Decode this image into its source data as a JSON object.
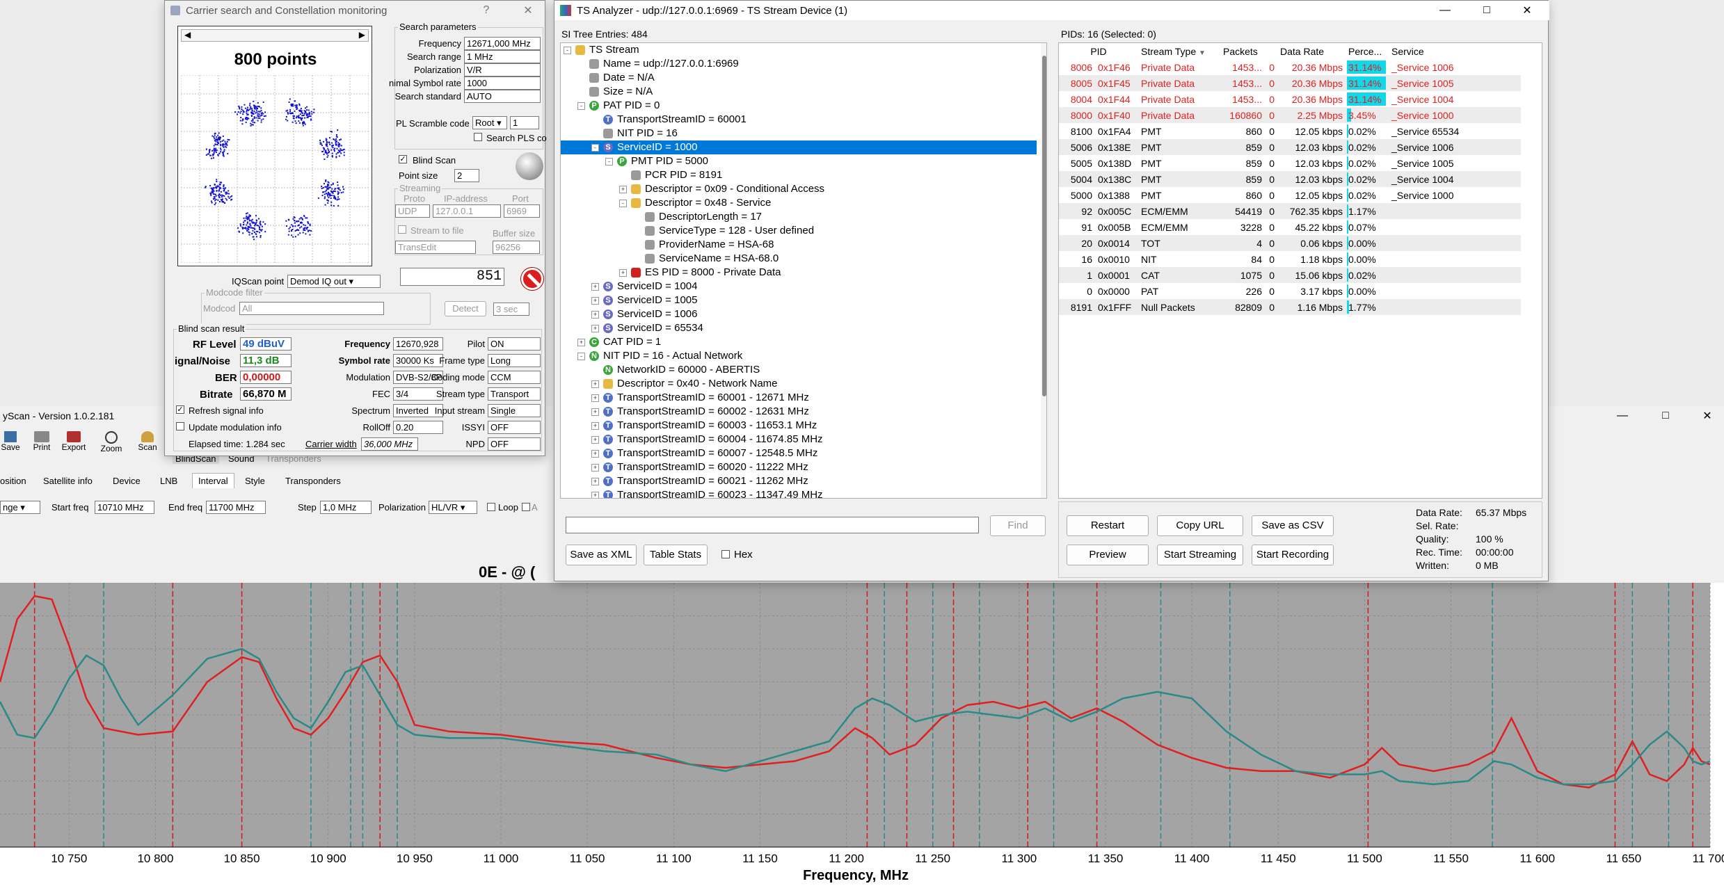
{
  "main": {
    "title": "yScan - Version 1.0.2.181",
    "toolbar": [
      "Save",
      "Print",
      "Export",
      "Zoom",
      "Scan",
      "BlindScan",
      "Sound",
      "Transponders"
    ],
    "tabs": [
      "osition",
      "Satellite info",
      "Device",
      "LNB",
      "Interval",
      "Style",
      "Transponders"
    ],
    "controls": {
      "range_value": "nge",
      "start_label": "Start freq",
      "start_value": "10710 MHz",
      "end_label": "End freq",
      "end_value": "11700 MHz",
      "step_label": "Step",
      "step_value": "1,0 MHz",
      "pol_label": "Polarization",
      "pol_value": "HL/VR",
      "loop_label": "Loop",
      "a_label": "A"
    },
    "chart_heading": "0E - @ ("
  },
  "carrier": {
    "title": "Carrier search and Constellation monitoring",
    "title_help": "?",
    "points_label": "800 points",
    "search_params_title": "Search parameters",
    "params": [
      {
        "label": "Frequency",
        "value": "12671,000 MHz"
      },
      {
        "label": "Search range",
        "value": "1 MHz"
      },
      {
        "label": "Polarization",
        "value": "V/R"
      },
      {
        "label": "nimal Symbol rate",
        "value": "1000"
      },
      {
        "label": "Search standard",
        "value": "AUTO"
      }
    ],
    "pls_label": "PL Scramble code",
    "pls_value": "Root",
    "pls_num": "1",
    "search_pls": "Search PLS co",
    "blind_scan": "Blind Scan",
    "point_size_label": "Point size",
    "point_size": "2",
    "streaming_title": "Streaming",
    "proto_label": "Proto",
    "ip_label": "IP-address",
    "port_label": "Port",
    "proto": "UDP",
    "ip": "127.0.0.1",
    "port": "6969",
    "stream_to_file": "Stream to file",
    "buffer_label": "Buffer size",
    "stream_app": "TransEdit",
    "buffer": "96256",
    "counter": "851",
    "iq_label": "IQScan point",
    "iq_value": "Demod IQ out",
    "modcode_title": "Modcode filter",
    "modcode_label": "Modcod",
    "modcode_value": "All",
    "detect": "Detect",
    "detect_time": "3 sec",
    "result_title": "Blind scan result",
    "rf_label": "RF Level",
    "rf_value": "49 dBuV",
    "snr_label": "ignal/Noise",
    "snr_value": "11,3 dB",
    "ber_label": "BER",
    "ber_value": "0,00000",
    "bitrate_label": "Bitrate",
    "bitrate_value": "66,870 M",
    "mid": [
      {
        "label": "Frequency",
        "value": "12670,928"
      },
      {
        "label": "Symbol rate",
        "value": "30000 Ks"
      },
      {
        "label": "Modulation",
        "value": "DVB-S2/8PSK"
      },
      {
        "label": "FEC",
        "value": "3/4"
      },
      {
        "label": "Spectrum",
        "value": "Inverted"
      },
      {
        "label": "RollOff",
        "value": "0.20"
      }
    ],
    "right": [
      {
        "label": "Pilot",
        "value": "ON"
      },
      {
        "label": "Frame type",
        "value": "Long"
      },
      {
        "label": "Coding mode",
        "value": "CCM"
      },
      {
        "label": "Stream type",
        "value": "Transport"
      },
      {
        "label": "Input stream",
        "value": "Single"
      },
      {
        "label": "ISSYI",
        "value": "OFF"
      },
      {
        "label": "NPD",
        "value": "OFF"
      }
    ],
    "refresh": "Refresh signal info",
    "update_mod": "Update modulation info",
    "elapsed": "Elapsed time: 1.284 sec",
    "carrier_width_label": "Carrier width",
    "carrier_width": "36,000 MHz"
  },
  "ts": {
    "title": "TS Analyzer - udp://127.0.0.1:6969 - TS Stream Device (1)",
    "si_header": "SI Tree Entries: 484",
    "pids_header": "PIDs: 16   (Selected: 0)",
    "tree": [
      {
        "d": 0,
        "pm": "-",
        "icon": "folder",
        "text": "TS Stream"
      },
      {
        "d": 1,
        "pm": "",
        "icon": "grey",
        "text": "Name = udp://127.0.0.1:6969"
      },
      {
        "d": 1,
        "pm": "",
        "icon": "grey",
        "text": "Date = N/A"
      },
      {
        "d": 1,
        "pm": "",
        "icon": "grey",
        "text": "Size = N/A"
      },
      {
        "d": 1,
        "pm": "-",
        "icon": "P",
        "text": "PAT PID = 0"
      },
      {
        "d": 2,
        "pm": "",
        "icon": "T",
        "text": "TransportStreamID = 60001"
      },
      {
        "d": 2,
        "pm": "",
        "icon": "grey",
        "text": "NIT PID = 16"
      },
      {
        "d": 2,
        "pm": "-",
        "icon": "S",
        "text": "ServiceID = 1000",
        "sel": true
      },
      {
        "d": 3,
        "pm": "-",
        "icon": "P",
        "text": "PMT PID = 5000"
      },
      {
        "d": 4,
        "pm": "",
        "icon": "grey",
        "text": "PCR PID = 8191"
      },
      {
        "d": 4,
        "pm": "+",
        "icon": "folder",
        "text": "Descriptor = 0x09 - Conditional Access"
      },
      {
        "d": 4,
        "pm": "-",
        "icon": "folder",
        "text": "Descriptor = 0x48 - Service"
      },
      {
        "d": 5,
        "pm": "",
        "icon": "grey",
        "text": "DescriptorLength = 17"
      },
      {
        "d": 5,
        "pm": "",
        "icon": "grey",
        "text": "ServiceType = 128 - User defined"
      },
      {
        "d": 5,
        "pm": "",
        "icon": "grey",
        "text": "ProviderName = HSA-68"
      },
      {
        "d": 5,
        "pm": "",
        "icon": "grey",
        "text": "ServiceName = HSA-68.0"
      },
      {
        "d": 4,
        "pm": "+",
        "icon": "red",
        "text": "ES PID = 8000 - Private Data"
      },
      {
        "d": 2,
        "pm": "+",
        "icon": "S",
        "text": "ServiceID = 1004"
      },
      {
        "d": 2,
        "pm": "+",
        "icon": "S",
        "text": "ServiceID = 1005"
      },
      {
        "d": 2,
        "pm": "+",
        "icon": "S",
        "text": "ServiceID = 1006"
      },
      {
        "d": 2,
        "pm": "+",
        "icon": "S",
        "text": "ServiceID = 65534"
      },
      {
        "d": 1,
        "pm": "+",
        "icon": "C",
        "text": "CAT PID = 1"
      },
      {
        "d": 1,
        "pm": "-",
        "icon": "N",
        "text": "NIT PID = 16 - Actual Network"
      },
      {
        "d": 2,
        "pm": "",
        "icon": "N",
        "text": "NetworkID = 60000 - ABERTIS"
      },
      {
        "d": 2,
        "pm": "+",
        "icon": "folder",
        "text": "Descriptor = 0x40 - Network Name"
      },
      {
        "d": 2,
        "pm": "+",
        "icon": "T",
        "text": "TransportStreamID = 60001 - 12671 MHz"
      },
      {
        "d": 2,
        "pm": "+",
        "icon": "T",
        "text": "TransportStreamID = 60002 - 12631 MHz"
      },
      {
        "d": 2,
        "pm": "+",
        "icon": "T",
        "text": "TransportStreamID = 60003 - 11653.1 MHz"
      },
      {
        "d": 2,
        "pm": "+",
        "icon": "T",
        "text": "TransportStreamID = 60004 - 11674.85 MHz"
      },
      {
        "d": 2,
        "pm": "+",
        "icon": "T",
        "text": "TransportStreamID = 60007 - 12548.5 MHz"
      },
      {
        "d": 2,
        "pm": "+",
        "icon": "T",
        "text": "TransportStreamID = 60020 - 11222 MHz"
      },
      {
        "d": 2,
        "pm": "+",
        "icon": "T",
        "text": "TransportStreamID = 60021 - 11262 MHz"
      },
      {
        "d": 2,
        "pm": "+",
        "icon": "T",
        "text": "TransportStreamID = 60023 - 11347.49 MHz"
      }
    ],
    "columns": [
      "PID",
      "Stream Type",
      "Packets",
      "Data Rate",
      "Perce...",
      "Service"
    ],
    "rows": [
      {
        "pid": "8006",
        "hex": "0x1F46",
        "type": "Private Data",
        "packets": "1453...",
        "err": "0",
        "rate": "20.36 Mbps",
        "pct": "31.14%",
        "pctv": 31.14,
        "service": "_Service 1006",
        "red": true
      },
      {
        "pid": "8005",
        "hex": "0x1F45",
        "type": "Private Data",
        "packets": "1453...",
        "err": "0",
        "rate": "20.36 Mbps",
        "pct": "31.14%",
        "pctv": 31.14,
        "service": "_Service 1005",
        "red": true
      },
      {
        "pid": "8004",
        "hex": "0x1F44",
        "type": "Private Data",
        "packets": "1453...",
        "err": "0",
        "rate": "20.36 Mbps",
        "pct": "31.14%",
        "pctv": 31.14,
        "service": "_Service 1004",
        "red": true
      },
      {
        "pid": "8000",
        "hex": "0x1F40",
        "type": "Private Data",
        "packets": "160860",
        "err": "0",
        "rate": "2.25 Mbps",
        "pct": "3.45%",
        "pctv": 3.45,
        "service": "_Service 1000",
        "red": true
      },
      {
        "pid": "8100",
        "hex": "0x1FA4",
        "type": "PMT",
        "packets": "860",
        "err": "0",
        "rate": "12.05 kbps",
        "pct": "0.02%",
        "pctv": 0.02,
        "service": "_Service 65534",
        "red": false
      },
      {
        "pid": "5006",
        "hex": "0x138E",
        "type": "PMT",
        "packets": "859",
        "err": "0",
        "rate": "12.03 kbps",
        "pct": "0.02%",
        "pctv": 0.02,
        "service": "_Service 1006",
        "red": false
      },
      {
        "pid": "5005",
        "hex": "0x138D",
        "type": "PMT",
        "packets": "859",
        "err": "0",
        "rate": "12.03 kbps",
        "pct": "0.02%",
        "pctv": 0.02,
        "service": "_Service 1005",
        "red": false
      },
      {
        "pid": "5004",
        "hex": "0x138C",
        "type": "PMT",
        "packets": "859",
        "err": "0",
        "rate": "12.03 kbps",
        "pct": "0.02%",
        "pctv": 0.02,
        "service": "_Service 1004",
        "red": false
      },
      {
        "pid": "5000",
        "hex": "0x1388",
        "type": "PMT",
        "packets": "860",
        "err": "0",
        "rate": "12.05 kbps",
        "pct": "0.02%",
        "pctv": 0.02,
        "service": "_Service 1000",
        "red": false
      },
      {
        "pid": "92",
        "hex": "0x005C",
        "type": "ECM/EMM",
        "packets": "54419",
        "err": "0",
        "rate": "762.35 kbps",
        "pct": "1.17%",
        "pctv": 1.17,
        "service": "",
        "red": false
      },
      {
        "pid": "91",
        "hex": "0x005B",
        "type": "ECM/EMM",
        "packets": "3228",
        "err": "0",
        "rate": "45.22 kbps",
        "pct": "0.07%",
        "pctv": 0.07,
        "service": "",
        "red": false
      },
      {
        "pid": "20",
        "hex": "0x0014",
        "type": "TOT",
        "packets": "4",
        "err": "0",
        "rate": "0.06 kbps",
        "pct": "0.00%",
        "pctv": 0,
        "service": "",
        "red": false
      },
      {
        "pid": "16",
        "hex": "0x0010",
        "type": "NIT",
        "packets": "84",
        "err": "0",
        "rate": "1.18 kbps",
        "pct": "0.00%",
        "pctv": 0,
        "service": "",
        "red": false
      },
      {
        "pid": "1",
        "hex": "0x0001",
        "type": "CAT",
        "packets": "1075",
        "err": "0",
        "rate": "15.06 kbps",
        "pct": "0.02%",
        "pctv": 0.02,
        "service": "",
        "red": false
      },
      {
        "pid": "0",
        "hex": "0x0000",
        "type": "PAT",
        "packets": "226",
        "err": "0",
        "rate": "3.17 kbps",
        "pct": "0.00%",
        "pctv": 0,
        "service": "",
        "red": false
      },
      {
        "pid": "8191",
        "hex": "0x1FFF",
        "type": "Null Packets",
        "packets": "82809",
        "err": "0",
        "rate": "1.16 Mbps",
        "pct": "1.77%",
        "pctv": 1.77,
        "service": "",
        "red": false
      }
    ],
    "find": "Find",
    "save_xml": "Save as XML",
    "table_stats": "Table Stats",
    "hex": "Hex",
    "restart": "Restart",
    "copy_url": "Copy URL",
    "save_csv": "Save as CSV",
    "preview": "Preview",
    "start_streaming": "Start Streaming",
    "start_recording": "Start Recording",
    "stats": [
      {
        "label": "Data Rate:",
        "value": "65.37 Mbps"
      },
      {
        "label": "Sel. Rate:",
        "value": ""
      },
      {
        "label": "Quality:",
        "value": "100 %"
      },
      {
        "label": "Rec. Time:",
        "value": "00:00:00"
      },
      {
        "label": "Written:",
        "value": "0 MB"
      }
    ]
  },
  "chart_data": {
    "type": "line",
    "xlabel": "Frequency, MHz",
    "xlim": [
      10710,
      11700
    ],
    "x_ticks": [
      "10 750",
      "10 800",
      "10 850",
      "10 900",
      "10 950",
      "11 000",
      "11 050",
      "11 100",
      "11 150",
      "11 200",
      "11 250",
      "11 300",
      "11 350",
      "11 400",
      "11 450",
      "11 500",
      "11 550",
      "11 600",
      "11 650",
      "11 700"
    ],
    "series": [
      {
        "color": "#e02020",
        "x": [
          10710,
          10720,
          10730,
          10740,
          10750,
          10760,
          10770,
          10790,
          10810,
          10830,
          10850,
          10860,
          10870,
          10880,
          10890,
          10900,
          10910,
          10920,
          10930,
          10940,
          10950,
          10970,
          11000,
          11030,
          11060,
          11090,
          11110,
          11130,
          11150,
          11170,
          11190,
          11205,
          11215,
          11225,
          11240,
          11255,
          11270,
          11285,
          11300,
          11315,
          11330,
          11345,
          11360,
          11380,
          11400,
          11420,
          11440,
          11460,
          11480,
          11500,
          11510,
          11520,
          11540,
          11560,
          11575,
          11585,
          11600,
          11615,
          11630,
          11645,
          11655,
          11665,
          11675,
          11685,
          11690,
          11695,
          11700
        ],
        "y": [
          20,
          58,
          72,
          70,
          42,
          10,
          -8,
          -12,
          -10,
          20,
          35,
          32,
          10,
          -8,
          -12,
          -2,
          14,
          32,
          36,
          20,
          -6,
          -10,
          -12,
          -16,
          -18,
          -26,
          -30,
          -32,
          -30,
          -28,
          -22,
          -8,
          -14,
          -24,
          -18,
          -2,
          6,
          8,
          4,
          8,
          -2,
          4,
          -4,
          -18,
          -26,
          -32,
          -34,
          -34,
          -38,
          -30,
          -20,
          -30,
          -34,
          -30,
          -22,
          -2,
          -34,
          -42,
          -44,
          -36,
          -16,
          -36,
          -40,
          -30,
          -20,
          -28,
          -30
        ]
      },
      {
        "color": "#2a8a88",
        "x": [
          10710,
          10720,
          10730,
          10740,
          10750,
          10760,
          10770,
          10780,
          10790,
          10810,
          10830,
          10850,
          10860,
          10870,
          10880,
          10890,
          10900,
          10910,
          10920,
          10930,
          10940,
          10950,
          10970,
          11000,
          11030,
          11060,
          11090,
          11110,
          11130,
          11150,
          11170,
          11190,
          11205,
          11215,
          11225,
          11240,
          11255,
          11270,
          11285,
          11300,
          11315,
          11330,
          11345,
          11360,
          11380,
          11400,
          11420,
          11440,
          11460,
          11480,
          11500,
          11510,
          11520,
          11540,
          11560,
          11575,
          11585,
          11600,
          11615,
          11630,
          11645,
          11655,
          11665,
          11675,
          11685,
          11690,
          11695,
          11700
        ],
        "y": [
          8,
          -12,
          -14,
          2,
          22,
          36,
          30,
          10,
          -6,
          12,
          34,
          40,
          34,
          14,
          -2,
          -8,
          8,
          26,
          30,
          12,
          -6,
          -12,
          -14,
          -14,
          -18,
          -22,
          -24,
          -30,
          -34,
          -28,
          -22,
          -16,
          4,
          10,
          6,
          -4,
          0,
          2,
          0,
          -2,
          4,
          -4,
          2,
          10,
          14,
          10,
          -10,
          -24,
          -34,
          -36,
          -36,
          -34,
          -40,
          -42,
          -40,
          -28,
          -30,
          -38,
          -42,
          -42,
          -40,
          -30,
          -18,
          -10,
          -20,
          -28,
          -30,
          -28
        ]
      }
    ],
    "markers_red": [
      10730,
      10810,
      10850,
      10930,
      11212,
      11235,
      11262,
      11305,
      11345,
      11502,
      11645,
      11690
    ],
    "markers_teal": [
      10770,
      10890,
      10913,
      10920,
      10940,
      11222,
      11250,
      11277,
      11320,
      11382,
      11422,
      11574,
      11655,
      11676
    ]
  }
}
